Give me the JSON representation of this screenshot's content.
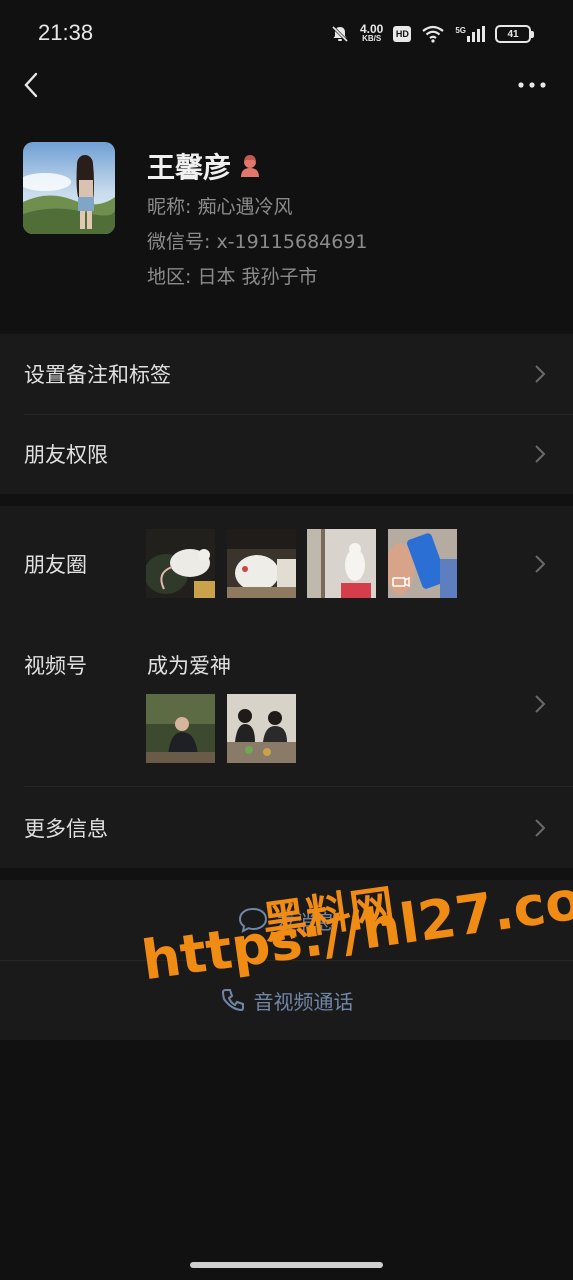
{
  "status_bar": {
    "time": "21:38",
    "net_speed_value": "4.00",
    "net_speed_unit": "KB/S",
    "hd": "HD",
    "signal": "5G",
    "battery": "41"
  },
  "nav": {
    "back_icon": "chevron-left-icon",
    "more_icon": "more-dots-icon"
  },
  "profile": {
    "name": "王馨彦",
    "nickname": "昵称: 痴心遇冷风",
    "wechat_id": "微信号: x-19115684691",
    "region": "地区: 日本  我孙子市"
  },
  "rows": {
    "remark_tags": "设置备注和标签",
    "permissions": "朋友权限",
    "moments": "朋友圈",
    "channels": "视频号",
    "channels_name": "成为爱神",
    "more_info": "更多信息"
  },
  "actions": {
    "message": "发消息",
    "call": "音视频通话"
  },
  "watermark": {
    "line1": "黑料网",
    "line2": "https://hl27.co"
  },
  "colors": {
    "background": "#111111",
    "panel": "#1a1a1a",
    "action_link": "#7186a6",
    "watermark": "#f08b14"
  }
}
